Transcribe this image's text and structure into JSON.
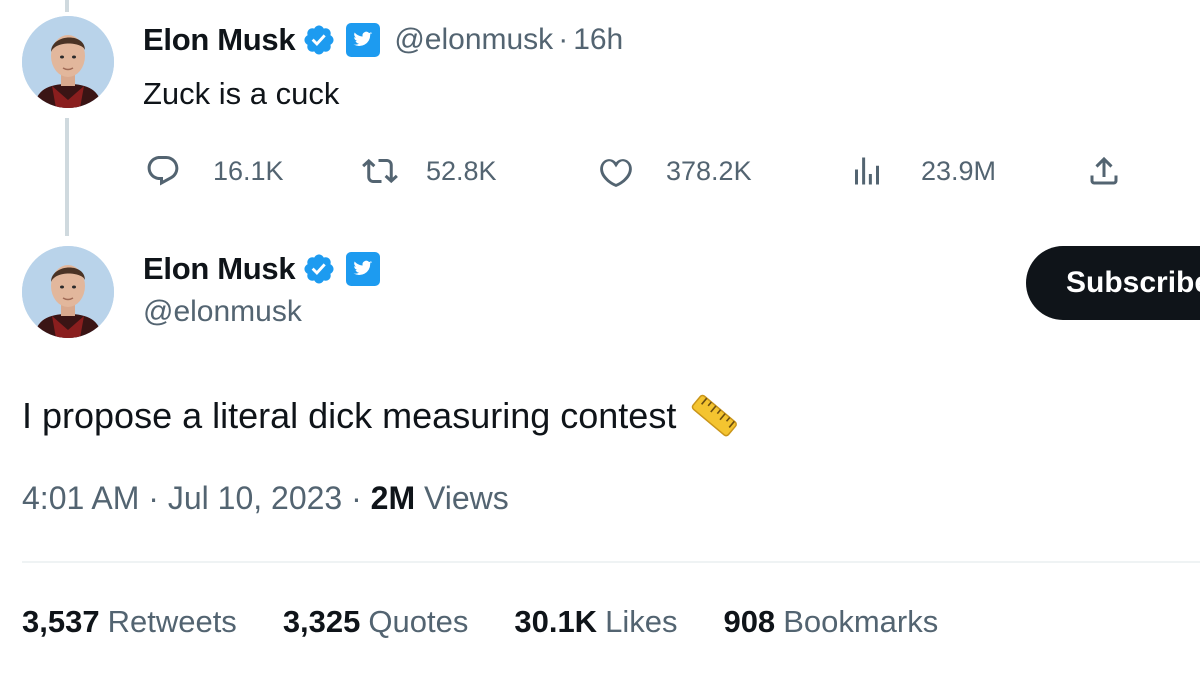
{
  "reply_tweet": {
    "display_name": "Elon Musk",
    "handle": "@elonmusk",
    "separator": "·",
    "time": "16h",
    "text": "Zuck is a cuck",
    "actions": {
      "replies": "16.1K",
      "retweets": "52.8K",
      "likes": "378.2K",
      "views": "23.9M"
    }
  },
  "main_tweet": {
    "display_name": "Elon Musk",
    "handle": "@elonmusk",
    "subscribe_label": "Subscribe",
    "text": "I propose a literal dick measuring contest",
    "emoji_icon": "straight-ruler-icon",
    "time": "4:01 AM",
    "date": "Jul 10, 2023",
    "separator": "·",
    "views_count": "2M",
    "views_label": "Views",
    "stats": {
      "retweets_count": "3,537",
      "retweets_label": "Retweets",
      "quotes_count": "3,325",
      "quotes_label": "Quotes",
      "likes_count": "30.1K",
      "likes_label": "Likes",
      "bookmarks_count": "908",
      "bookmarks_label": "Bookmarks"
    }
  },
  "colors": {
    "text_primary": "#0f1419",
    "text_secondary": "#536471",
    "verified_blue": "#1d9bf0",
    "thread_line": "#cfd9de",
    "button_dark": "#0f1419"
  }
}
